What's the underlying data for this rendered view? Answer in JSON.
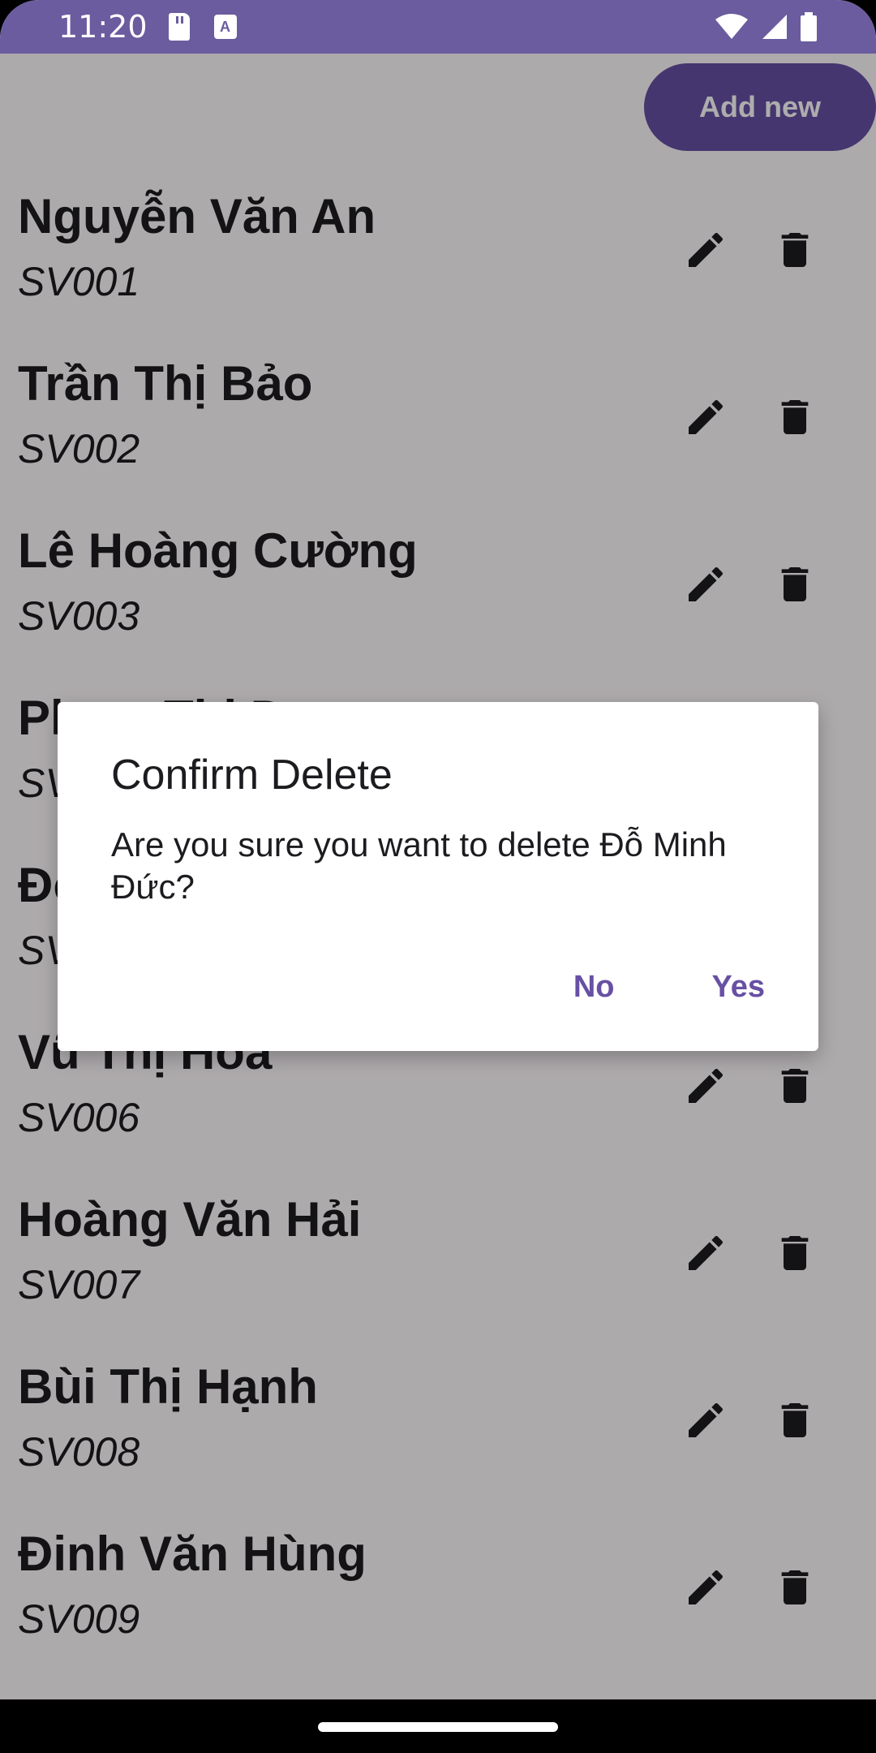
{
  "status_bar": {
    "time": "11:20",
    "icons": [
      "sd-card-icon",
      "keyboard-a-icon",
      "wifi-icon",
      "signal-icon",
      "battery-icon"
    ]
  },
  "toolbar": {
    "add_label": "Add new"
  },
  "students": [
    {
      "name": "Nguyễn Văn An",
      "code": "SV001"
    },
    {
      "name": "Trần Thị Bảo",
      "code": "SV002"
    },
    {
      "name": "Lê Hoàng Cường",
      "code": "SV003"
    },
    {
      "name": "Phạm Thị D",
      "code": "SV004"
    },
    {
      "name": "Đỗ Minh Đức",
      "code": "SV005"
    },
    {
      "name": "Vũ Thị Hoa",
      "code": "SV006"
    },
    {
      "name": "Hoàng Văn Hải",
      "code": "SV007"
    },
    {
      "name": "Bùi Thị Hạnh",
      "code": "SV008"
    },
    {
      "name": "Đinh Văn Hùng",
      "code": "SV009"
    }
  ],
  "dialog": {
    "title": "Confirm Delete",
    "message": "Are you sure you want to delete Đỗ Minh Đức?",
    "no_label": "No",
    "yes_label": "Yes"
  },
  "colors": {
    "primary": "#6750a4",
    "status_bar": "#6a5c9e",
    "background": "#fffbfe",
    "text": "#1c1b1f"
  }
}
